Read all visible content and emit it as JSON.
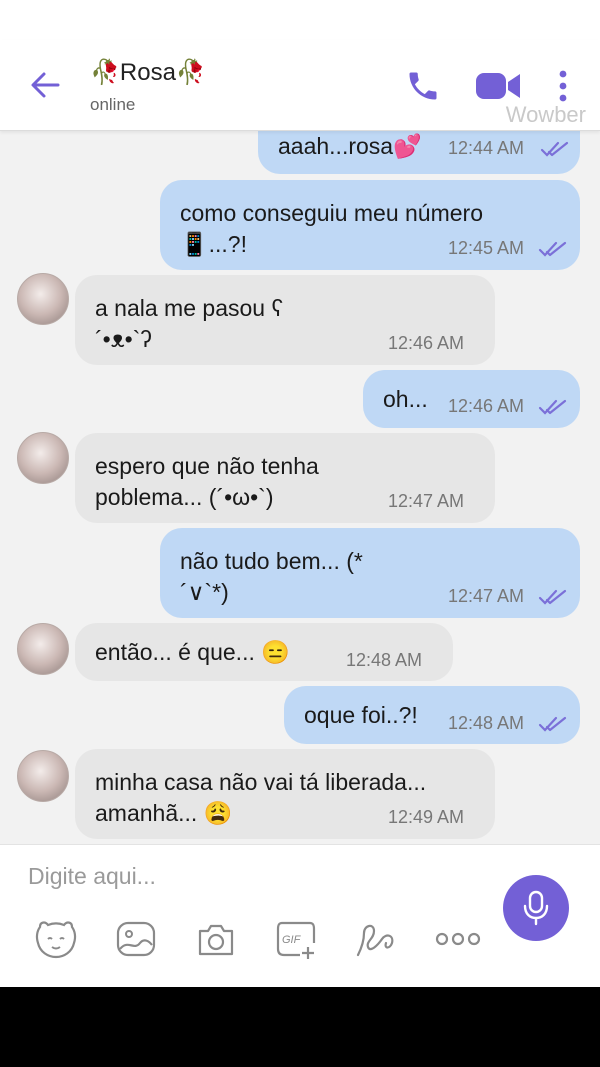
{
  "header": {
    "title": "🥀Rosa🥀",
    "status": "online",
    "watermark": "Wowber"
  },
  "messages": [
    {
      "dir": "out",
      "text": "aaah...rosa💕",
      "time": "12:44 AM",
      "read": true
    },
    {
      "dir": "out",
      "text": "como conseguiu meu número\n📱...?!",
      "time": "12:45 AM",
      "read": true
    },
    {
      "dir": "in",
      "text": "a nala me pasou ʕ\n´•ᴥ•`ʔ",
      "time": "12:46 AM"
    },
    {
      "dir": "out",
      "text": "oh...",
      "time": "12:46 AM",
      "read": true
    },
    {
      "dir": "in",
      "text": "espero que não tenha\npoblema... (´•ω•`)",
      "time": "12:47 AM"
    },
    {
      "dir": "out",
      "text": "não tudo bem... (*\n´∨`*)",
      "time": "12:47 AM",
      "read": true
    },
    {
      "dir": "in",
      "text": "então... é que... 😑",
      "time": "12:48 AM"
    },
    {
      "dir": "out",
      "text": "oque foi..?!",
      "time": "12:48 AM",
      "read": true
    },
    {
      "dir": "in",
      "text": "minha casa não vai tá liberada...\namanhã... 😩",
      "time": "12:49 AM"
    }
  ],
  "composer": {
    "placeholder": "Digite aqui..."
  },
  "colors": {
    "accent": "#7360d6",
    "outgoing_bubble": "#bfd8f5",
    "incoming_bubble": "#e6e6e6",
    "tick": "#7b70d8"
  },
  "icons": [
    "back-arrow-icon",
    "phone-icon",
    "video-icon",
    "more-icon",
    "sticker-icon",
    "gallery-icon",
    "camera-icon",
    "gif-icon",
    "doodle-icon",
    "more-options-icon",
    "mic-icon"
  ]
}
